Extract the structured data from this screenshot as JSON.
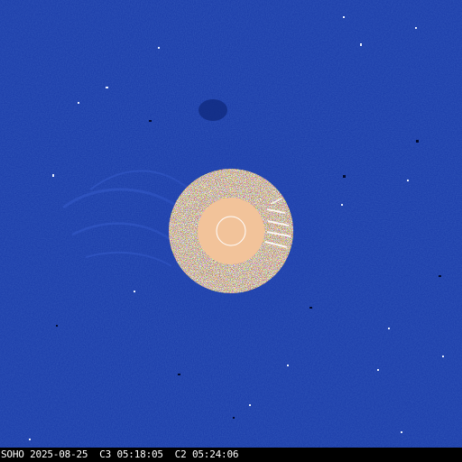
{
  "caption": "SOHO 2025-08-25  C3 05:18:05  C2 05:24:06",
  "colors": {
    "background_blue": "#1a3ba8",
    "corona_pattern_dark": "#2a1808",
    "corona_pattern_light": "#ffffff",
    "occulter_disk": "#f2c39a",
    "sun_outline": "#ffffff",
    "caption_bar": "#000000",
    "caption_text": "#ffffff"
  },
  "elements": {
    "outer_field": "LASCO C3 blue difference field",
    "inner_ring": "LASCO C2 speckled inner field",
    "occulter": "occulting disk",
    "sun_circle": "solar limb outline"
  }
}
